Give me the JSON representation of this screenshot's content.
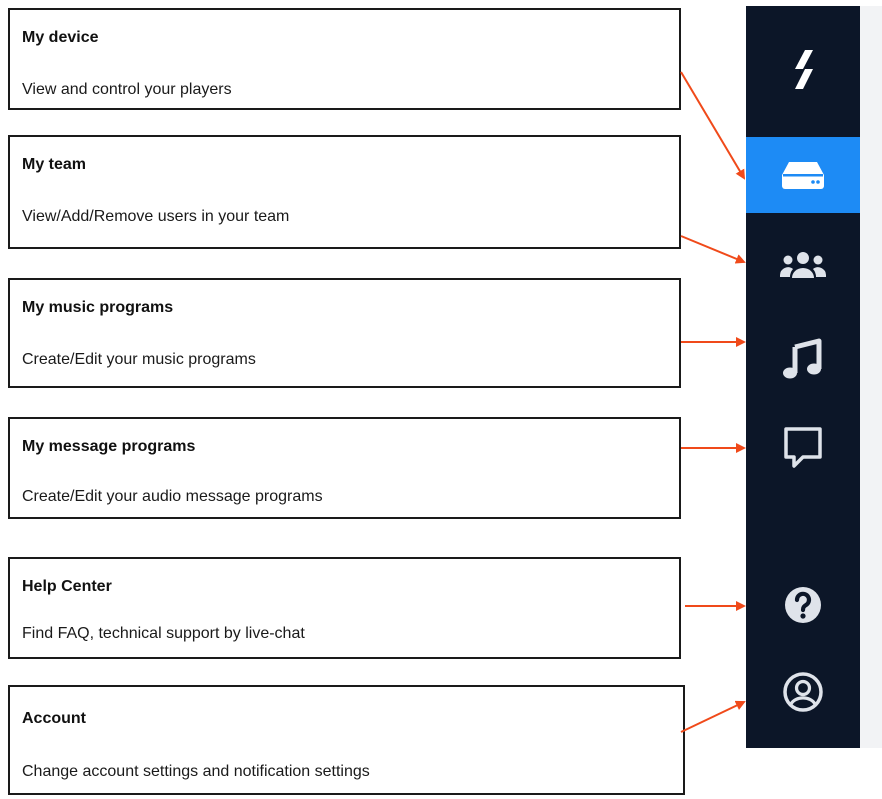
{
  "callouts": [
    {
      "title": "My device",
      "description": "View and control your players"
    },
    {
      "title": "My team",
      "description": "View/Add/Remove users in your team"
    },
    {
      "title": "My music programs",
      "description": "Create/Edit your music programs"
    },
    {
      "title": "My message programs",
      "description": "Create/Edit your audio message programs"
    },
    {
      "title": "Help Center",
      "description": "Find FAQ, technical support by live-chat"
    },
    {
      "title": "Account",
      "description": "Change account settings and notification settings"
    }
  ],
  "sidebar": {
    "logo_icon": "slash-logo-icon",
    "active_item": "device",
    "items": [
      {
        "id": "device",
        "icon": "device-drive-icon"
      },
      {
        "id": "team",
        "icon": "users-group-icon"
      },
      {
        "id": "music",
        "icon": "music-note-icon"
      },
      {
        "id": "message",
        "icon": "chat-bubble-icon"
      },
      {
        "id": "help",
        "icon": "question-circle-icon"
      },
      {
        "id": "account",
        "icon": "user-circle-icon"
      }
    ]
  },
  "colors": {
    "sidebar_bg": "#0c1628",
    "active_bg": "#1d8bf5",
    "arrow": "#f04a1a",
    "icon": "#ffffff",
    "icon_muted": "#dfe3ea"
  }
}
